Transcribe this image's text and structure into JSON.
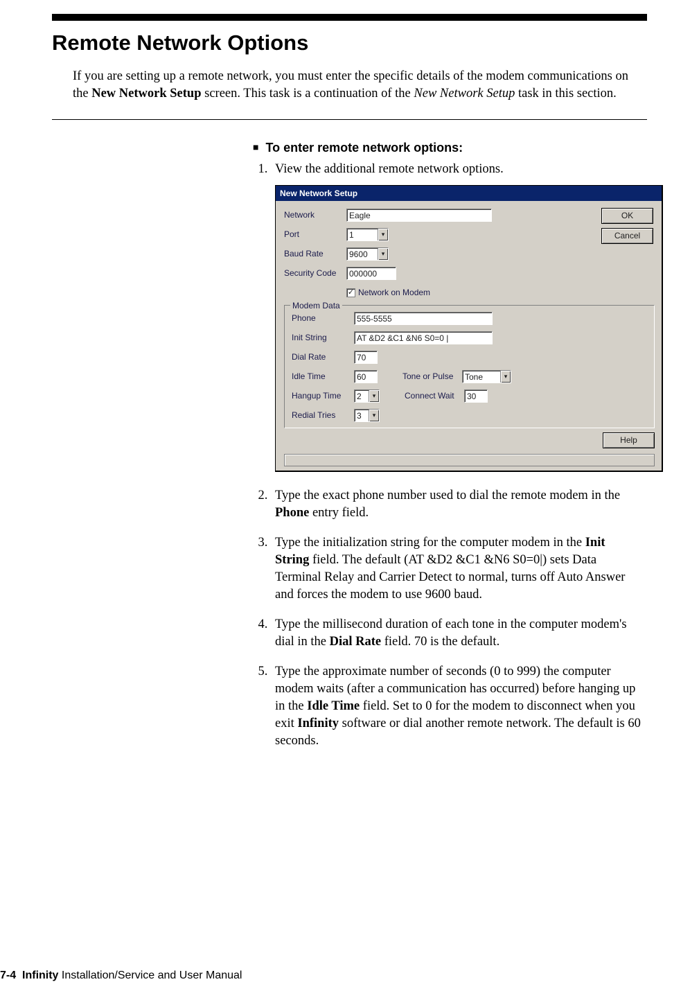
{
  "page": {
    "title": "Remote Network Options",
    "intro_parts": {
      "a": "If you are setting up a remote network, you must enter the specific details of the modem communications on the ",
      "b": "New Network Setup",
      "c": " screen. This task is a continuation of the ",
      "d": "New Network Setup",
      "e": " task in this section."
    },
    "task_heading": "To enter remote network options:",
    "steps": {
      "s1": "View the additional remote network options.",
      "s2": {
        "a": "Type the exact phone number used to dial the remote modem in the ",
        "b": "Phone",
        "c": " entry field."
      },
      "s3": {
        "a": "Type the initialization string for the computer modem in the ",
        "b": "Init String",
        "c": " field. The default (AT &D2 &C1 &N6 S0=0|) sets Data Terminal Relay and Carrier Detect to normal, turns off Auto Answer and forces the modem to use 9600 baud."
      },
      "s4": {
        "a": "Type the millisecond duration of each tone in the computer modem's dial in the ",
        "b": "Dial Rate",
        "c": " field. 70 is the default."
      },
      "s5": {
        "a": "Type the approximate number of seconds (0 to 999) the computer modem waits (after a communication has occurred) before hanging up in the ",
        "b": "Idle Time",
        "c": " field. Set to 0 for the modem to disconnect when you exit ",
        "d": "Infinity",
        "e": " software or dial another remote network. The default is 60 seconds."
      }
    },
    "footer": {
      "pagenum": "7-4",
      "book": "Infinity",
      "rest": " Installation/Service and User Manual"
    }
  },
  "dialog": {
    "title": "New Network Setup",
    "labels": {
      "network": "Network",
      "port": "Port",
      "baud": "Baud Rate",
      "security": "Security Code",
      "nom": "Network on Modem",
      "modem_group": "Modem Data",
      "phone": "Phone",
      "init": "Init String",
      "dial_rate": "Dial Rate",
      "idle": "Idle Time",
      "hangup": "Hangup Time",
      "redial": "Redial Tries",
      "tone_pulse": "Tone or Pulse",
      "connect_wait": "Connect Wait"
    },
    "values": {
      "network": "Eagle",
      "port": "1",
      "baud": "9600",
      "security": "000000",
      "nom_checked": "✓",
      "phone": "555-5555",
      "init": "AT &D2 &C1 &N6 S0=0 |",
      "dial_rate": "70",
      "idle": "60",
      "hangup": "2",
      "redial": "3",
      "tone_pulse": "Tone",
      "connect_wait": "30"
    },
    "buttons": {
      "ok": "OK",
      "cancel": "Cancel",
      "help": "Help"
    }
  }
}
